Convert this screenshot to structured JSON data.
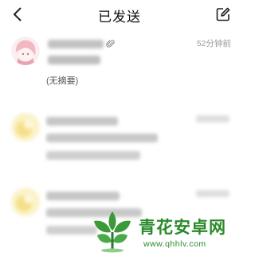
{
  "header": {
    "title": "已发送",
    "back_icon": "chevron-left-icon",
    "compose_icon": "compose-icon"
  },
  "mails": [
    {
      "time": "52分钟前",
      "summary": "(无摘要)",
      "has_attachment": true
    },
    {
      "time": "",
      "summary": ""
    },
    {
      "time": "",
      "summary": ""
    }
  ],
  "watermark": {
    "text": "青花安卓网",
    "url": "www.qhhlv.com",
    "color": "#2a8a2a"
  }
}
